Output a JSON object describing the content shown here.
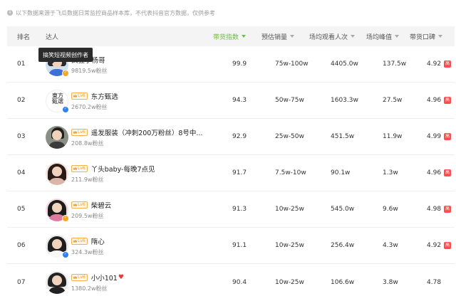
{
  "notice": "以下数据来源于飞瓜数据日常监控商品样本库，不代表抖音官方数据，仅供参考",
  "columns": {
    "rank": "排名",
    "anchor": "达人",
    "score": "带货指数",
    "sales": "预估销量",
    "views": "场均观看人次",
    "peak": "场均峰值",
    "rating": "带货口碑"
  },
  "tooltip": "搞笑短视频创作者",
  "high_badge": "高",
  "colors": {
    "accent": "#6ac13e",
    "high": "#ff4d4f",
    "level": "#f0a020"
  },
  "rows": [
    {
      "rank": "01",
      "level": "",
      "name": "疯狂小杨哥",
      "fans": "9819.5w粉丝",
      "score": "99.9",
      "sales": "75w-100w",
      "views": "4405.0w",
      "peak": "137.5w",
      "rating": "4.92",
      "verify": "gold"
    },
    {
      "rank": "02",
      "level": "Lv6",
      "name": "东方甄选",
      "fans": "2670.2w粉丝",
      "score": "94.3",
      "sales": "50w-75w",
      "views": "1603.3w",
      "peak": "27.5w",
      "rating": "4.96",
      "verify": "blue"
    },
    {
      "rank": "03",
      "level": "Lv6",
      "name": "遥发服装（冲刺200万粉丝）8号中...",
      "fans": "208.8w粉丝",
      "score": "92.9",
      "sales": "25w-50w",
      "views": "451.5w",
      "peak": "11.9w",
      "rating": "4.99",
      "verify": ""
    },
    {
      "rank": "04",
      "level": "Lv6",
      "name": "丫头baby-每晚7点见",
      "fans": "211.9w粉丝",
      "score": "91.7",
      "sales": "7.5w-10w",
      "views": "90.1w",
      "peak": "1.3w",
      "rating": "4.96",
      "verify": ""
    },
    {
      "rank": "05",
      "level": "Lv6",
      "name": "柴碧云",
      "fans": "209.5w粉丝",
      "score": "91.3",
      "sales": "10w-25w",
      "views": "545.0w",
      "peak": "9.6w",
      "rating": "4.98",
      "verify": "gold"
    },
    {
      "rank": "06",
      "level": "Lv6",
      "name": "隋心",
      "fans": "324.3w粉丝",
      "score": "91.1",
      "sales": "10w-25w",
      "views": "256.4w",
      "peak": "4.3w",
      "rating": "4.92",
      "verify": "blue"
    },
    {
      "rank": "07",
      "level": "Lv6",
      "name": "小小101",
      "fans": "1380.2w粉丝",
      "score": "90.4",
      "sales": "10w-25w",
      "views": "106.6w",
      "peak": "3.8w",
      "rating": "4.78",
      "verify": ""
    }
  ]
}
